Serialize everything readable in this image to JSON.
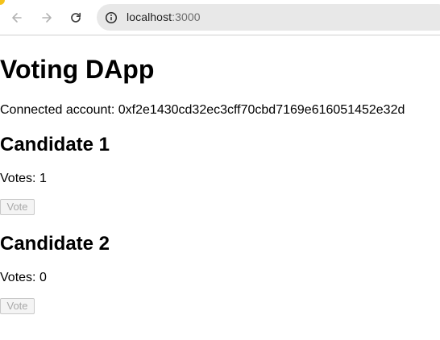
{
  "browser": {
    "url_host": "localhost",
    "url_port": ":3000",
    "icons": {
      "back": "arrow-left-icon",
      "forward": "arrow-right-icon",
      "reload": "reload-icon",
      "site_info": "info-icon"
    },
    "accent_color": "#f4c21a"
  },
  "page": {
    "title": "Voting DApp",
    "account_label": "Connected account:",
    "account_address": "0xf2e1430cd32ec3cff70cbd7169e616051452e32d"
  },
  "candidates": [
    {
      "name": "Candidate 1",
      "votes_label": "Votes:",
      "votes": "1",
      "button_label": "Vote"
    },
    {
      "name": "Candidate 2",
      "votes_label": "Votes:",
      "votes": "0",
      "button_label": "Vote"
    }
  ]
}
